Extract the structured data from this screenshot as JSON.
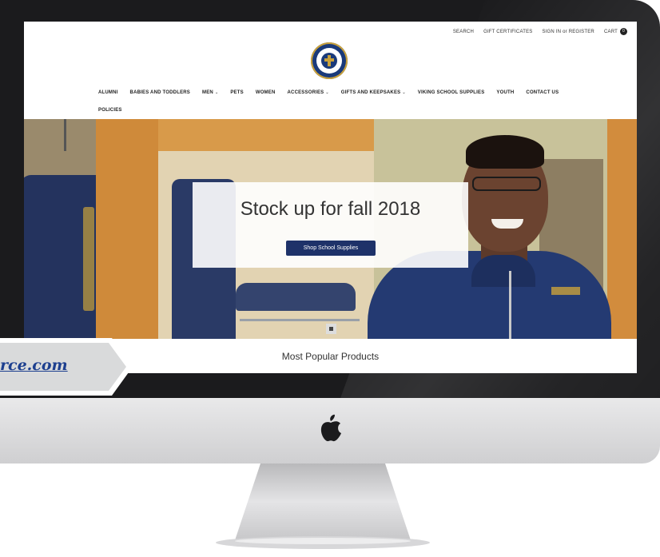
{
  "utility_nav": [
    "SEARCH",
    "GIFT CERTIFICATES",
    "SIGN IN or REGISTER",
    "CART"
  ],
  "cart_count": "0",
  "main_nav": [
    {
      "label": "ALUMNI",
      "dropdown": false
    },
    {
      "label": "BABIES AND TODDLERS",
      "dropdown": false
    },
    {
      "label": "MEN",
      "dropdown": true
    },
    {
      "label": "PETS",
      "dropdown": false
    },
    {
      "label": "WOMEN",
      "dropdown": false
    },
    {
      "label": "ACCESSORIES",
      "dropdown": true
    },
    {
      "label": "GIFTS AND KEEPSAKES",
      "dropdown": true
    },
    {
      "label": "VIKING SCHOOL SUPPLIES",
      "dropdown": false
    },
    {
      "label": "YOUTH",
      "dropdown": false
    },
    {
      "label": "CONTACT US",
      "dropdown": false
    },
    {
      "label": "POLICIES",
      "dropdown": false
    }
  ],
  "hero": {
    "title": "Stock up for fall 2018",
    "button": "Shop School Supplies"
  },
  "section_title": "Most Popular Products",
  "ribbon_link": "rce.com",
  "icons": {
    "logo": "school-crest-icon",
    "chevron": "chevron-down-icon",
    "cart": "cart-badge",
    "apple": "apple-logo-icon"
  },
  "colors": {
    "brand_navy": "#1e3269",
    "crest_gold": "#c9a13b",
    "link_blue": "#1d3f8f"
  }
}
